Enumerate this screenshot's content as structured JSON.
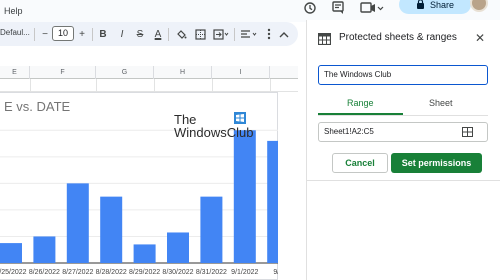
{
  "menu": {
    "help_label": "Help"
  },
  "header": {
    "share_label": "Share",
    "icons": [
      "history-icon",
      "comment-icon",
      "video-call-icon",
      "lock-icon",
      "avatar"
    ]
  },
  "toolbar": {
    "font_name": "Defaul...",
    "font_size": "10",
    "decrease_label": "−",
    "increase_label": "+",
    "bold_label": "B",
    "italic_label": "I",
    "strike_label": "S",
    "text_color_label": "A"
  },
  "sheet": {
    "column_headers": [
      "E",
      "F",
      "G",
      "H",
      "I"
    ]
  },
  "watermark": {
    "line1": "The",
    "line2": "WindowsClub"
  },
  "chart_data": {
    "type": "bar",
    "title": "E vs. DATE",
    "categories": [
      "8/25/2022",
      "8/26/2022",
      "8/27/2022",
      "8/28/2022",
      "8/29/2022",
      "8/30/2022",
      "8/31/2022",
      "9/1/2022",
      "9/2"
    ],
    "values": [
      1.5,
      2,
      6,
      5,
      1.4,
      2.3,
      5,
      10,
      9.2
    ],
    "ylim": [
      0,
      11
    ],
    "bar_color": "#4285f4",
    "grid": true,
    "legend": "none"
  },
  "panel": {
    "title": "Protected sheets & ranges",
    "description_value": "The Windows Club",
    "tabs": [
      "Range",
      "Sheet"
    ],
    "active_tab": "Range",
    "range_value": "Sheet1!A2:C5",
    "cancel_label": "Cancel",
    "set_permissions_label": "Set permissions",
    "accent_color": "#188038"
  }
}
